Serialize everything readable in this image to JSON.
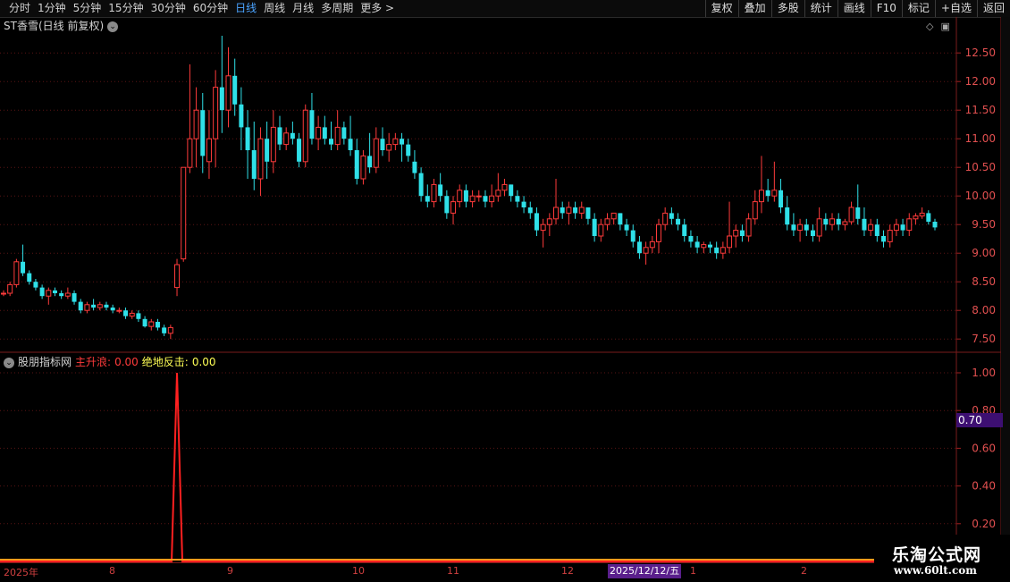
{
  "toolbar": {
    "periods": [
      "分时",
      "1分钟",
      "5分钟",
      "15分钟",
      "30分钟",
      "60分钟",
      "日线",
      "周线",
      "月线",
      "多周期",
      "更多 >"
    ],
    "active_period": "日线",
    "tools": [
      "复权",
      "叠加",
      "多股",
      "统计",
      "画线",
      "F10",
      "标记",
      "+自选",
      "返回"
    ]
  },
  "main_chart": {
    "title": "ST香雪(日线 前复权)",
    "price_axis": [
      "12.50",
      "12.00",
      "11.50",
      "11.00",
      "10.50",
      "10.00",
      "9.50",
      "9.00",
      "8.50",
      "8.00",
      "7.50"
    ]
  },
  "indicator": {
    "name": "股朋指标网",
    "line1_label": "主升浪:",
    "line1_value": "0.00",
    "line2_label": "绝地反击:",
    "line2_value": "0.00",
    "axis": [
      "1.00",
      "0.80",
      "0.60",
      "0.40",
      "0.20"
    ],
    "cursor_value": "0.70"
  },
  "date_axis": {
    "labels": [
      "2025年",
      "8",
      "9",
      "10",
      "11",
      "12",
      "1",
      "2"
    ],
    "highlight": "2025/12/12/五"
  },
  "watermark": {
    "line1": "乐淘公式网",
    "line2": "www.60lt.com"
  },
  "colors": {
    "up": "#ff3b3b",
    "down": "#2fe0e8",
    "background": "#000000",
    "grid": "#5a1414"
  },
  "chart_data": {
    "type": "candlestick",
    "ylim": [
      7.3,
      12.8
    ],
    "price_ticks": [
      7.5,
      8.0,
      8.5,
      9.0,
      9.5,
      10.0,
      10.5,
      11.0,
      11.5,
      12.0,
      12.5
    ],
    "candles": [
      [
        8.3,
        8.35,
        8.25,
        8.3
      ],
      [
        8.3,
        8.5,
        8.25,
        8.45
      ],
      [
        8.45,
        8.9,
        8.4,
        8.85
      ],
      [
        8.85,
        9.15,
        8.6,
        8.65
      ],
      [
        8.65,
        8.7,
        8.45,
        8.5
      ],
      [
        8.5,
        8.55,
        8.35,
        8.4
      ],
      [
        8.4,
        8.45,
        8.2,
        8.25
      ],
      [
        8.25,
        8.4,
        8.1,
        8.35
      ],
      [
        8.35,
        8.4,
        8.25,
        8.3
      ],
      [
        8.3,
        8.35,
        8.2,
        8.25
      ],
      [
        8.25,
        8.4,
        8.2,
        8.3
      ],
      [
        8.3,
        8.35,
        8.1,
        8.15
      ],
      [
        8.15,
        8.2,
        7.95,
        8.0
      ],
      [
        8.0,
        8.15,
        7.95,
        8.1
      ],
      [
        8.1,
        8.2,
        8.0,
        8.05
      ],
      [
        8.05,
        8.15,
        8.0,
        8.1
      ],
      [
        8.1,
        8.15,
        8.0,
        8.05
      ],
      [
        8.05,
        8.1,
        7.95,
        8.0
      ],
      [
        8.0,
        8.05,
        7.95,
        8.0
      ],
      [
        8.0,
        8.05,
        7.85,
        7.9
      ],
      [
        7.9,
        8.0,
        7.85,
        7.95
      ],
      [
        7.95,
        8.0,
        7.8,
        7.85
      ],
      [
        7.85,
        7.9,
        7.7,
        7.72
      ],
      [
        7.72,
        7.85,
        7.65,
        7.8
      ],
      [
        7.8,
        7.85,
        7.65,
        7.7
      ],
      [
        7.7,
        7.75,
        7.55,
        7.6
      ],
      [
        7.6,
        7.75,
        7.5,
        7.7
      ],
      [
        8.4,
        8.9,
        8.25,
        8.8
      ],
      [
        8.9,
        10.5,
        8.85,
        10.5
      ],
      [
        10.5,
        12.3,
        10.4,
        11.0
      ],
      [
        11.0,
        11.9,
        10.5,
        11.5
      ],
      [
        11.5,
        11.8,
        10.4,
        10.7
      ],
      [
        10.6,
        11.5,
        10.3,
        11.0
      ],
      [
        11.0,
        12.2,
        10.5,
        11.9
      ],
      [
        11.9,
        12.8,
        11.1,
        11.5
      ],
      [
        11.5,
        12.6,
        11.2,
        12.1
      ],
      [
        12.1,
        12.4,
        11.4,
        11.6
      ],
      [
        11.6,
        11.9,
        10.8,
        11.2
      ],
      [
        11.2,
        11.5,
        10.3,
        10.8
      ],
      [
        10.8,
        11.3,
        10.1,
        10.3
      ],
      [
        10.3,
        11.2,
        10.0,
        11.0
      ],
      [
        11.0,
        11.3,
        10.3,
        10.6
      ],
      [
        10.6,
        11.5,
        10.4,
        11.2
      ],
      [
        11.2,
        11.4,
        10.8,
        10.9
      ],
      [
        10.9,
        11.2,
        10.8,
        11.1
      ],
      [
        11.1,
        11.3,
        10.9,
        11.0
      ],
      [
        11.0,
        11.1,
        10.5,
        10.6
      ],
      [
        10.6,
        11.6,
        10.5,
        11.5
      ],
      [
        11.5,
        11.8,
        10.9,
        11.0
      ],
      [
        11.0,
        11.4,
        10.8,
        11.2
      ],
      [
        11.2,
        11.4,
        10.9,
        11.0
      ],
      [
        11.0,
        11.3,
        10.8,
        10.9
      ],
      [
        10.9,
        11.5,
        10.8,
        11.2
      ],
      [
        11.2,
        11.3,
        10.9,
        11.0
      ],
      [
        11.0,
        11.4,
        10.7,
        10.8
      ],
      [
        10.8,
        11.0,
        10.2,
        10.3
      ],
      [
        10.3,
        10.8,
        10.2,
        10.7
      ],
      [
        10.7,
        11.1,
        10.4,
        10.5
      ],
      [
        10.5,
        11.2,
        10.4,
        11.0
      ],
      [
        11.0,
        11.2,
        10.7,
        10.8
      ],
      [
        10.8,
        11.1,
        10.6,
        10.9
      ],
      [
        10.9,
        11.1,
        10.8,
        11.0
      ],
      [
        11.0,
        11.1,
        10.6,
        10.9
      ],
      [
        10.9,
        11.0,
        10.6,
        10.7
      ],
      [
        10.6,
        10.8,
        10.3,
        10.4
      ],
      [
        10.4,
        10.5,
        9.9,
        10.0
      ],
      [
        10.0,
        10.2,
        9.8,
        9.9
      ],
      [
        9.9,
        10.3,
        9.8,
        10.2
      ],
      [
        10.2,
        10.4,
        9.9,
        10.0
      ],
      [
        10.0,
        10.1,
        9.6,
        9.7
      ],
      [
        9.7,
        10.0,
        9.5,
        9.9
      ],
      [
        9.9,
        10.2,
        9.8,
        10.1
      ],
      [
        10.1,
        10.2,
        9.8,
        9.9
      ],
      [
        9.9,
        10.1,
        9.8,
        10.0
      ],
      [
        10.0,
        10.1,
        9.9,
        10.0
      ],
      [
        10.0,
        10.1,
        9.8,
        9.9
      ],
      [
        9.9,
        10.2,
        9.8,
        10.0
      ],
      [
        10.0,
        10.4,
        9.9,
        10.1
      ],
      [
        10.1,
        10.3,
        10.0,
        10.2
      ],
      [
        10.2,
        10.2,
        9.9,
        10.0
      ],
      [
        10.0,
        10.1,
        9.8,
        9.9
      ],
      [
        9.9,
        10.0,
        9.7,
        9.8
      ],
      [
        9.8,
        9.9,
        9.6,
        9.7
      ],
      [
        9.7,
        9.8,
        9.3,
        9.4
      ],
      [
        9.4,
        9.6,
        9.1,
        9.5
      ],
      [
        9.5,
        9.7,
        9.3,
        9.6
      ],
      [
        9.6,
        10.3,
        9.5,
        9.8
      ],
      [
        9.8,
        9.9,
        9.6,
        9.7
      ],
      [
        9.7,
        9.9,
        9.5,
        9.8
      ],
      [
        9.8,
        9.9,
        9.6,
        9.7
      ],
      [
        9.7,
        9.9,
        9.6,
        9.8
      ],
      [
        9.8,
        9.8,
        9.5,
        9.6
      ],
      [
        9.6,
        9.7,
        9.2,
        9.3
      ],
      [
        9.3,
        9.6,
        9.2,
        9.5
      ],
      [
        9.5,
        9.7,
        9.4,
        9.6
      ],
      [
        9.6,
        9.7,
        9.5,
        9.7
      ],
      [
        9.7,
        9.7,
        9.4,
        9.5
      ],
      [
        9.5,
        9.6,
        9.3,
        9.4
      ],
      [
        9.4,
        9.5,
        9.1,
        9.2
      ],
      [
        9.2,
        9.3,
        8.9,
        9.0
      ],
      [
        9.0,
        9.2,
        8.8,
        9.1
      ],
      [
        9.1,
        9.3,
        9.0,
        9.2
      ],
      [
        9.2,
        9.6,
        9.0,
        9.5
      ],
      [
        9.5,
        9.8,
        9.4,
        9.7
      ],
      [
        9.7,
        9.8,
        9.5,
        9.6
      ],
      [
        9.6,
        9.7,
        9.4,
        9.5
      ],
      [
        9.5,
        9.6,
        9.2,
        9.3
      ],
      [
        9.3,
        9.4,
        9.1,
        9.2
      ],
      [
        9.2,
        9.3,
        9.0,
        9.1
      ],
      [
        9.1,
        9.2,
        9.0,
        9.15
      ],
      [
        9.15,
        9.2,
        9.0,
        9.1
      ],
      [
        9.1,
        9.2,
        8.9,
        9.0
      ],
      [
        9.0,
        9.2,
        8.9,
        9.1
      ],
      [
        9.1,
        9.9,
        9.0,
        9.3
      ],
      [
        9.3,
        9.5,
        9.1,
        9.4
      ],
      [
        9.4,
        9.5,
        9.2,
        9.3
      ],
      [
        9.3,
        9.7,
        9.2,
        9.6
      ],
      [
        9.6,
        10.1,
        9.5,
        9.9
      ],
      [
        9.9,
        10.7,
        9.7,
        10.1
      ],
      [
        10.1,
        10.3,
        9.9,
        10.0
      ],
      [
        10.0,
        10.6,
        9.9,
        10.1
      ],
      [
        10.1,
        10.3,
        9.7,
        9.8
      ],
      [
        9.8,
        10.0,
        9.4,
        9.5
      ],
      [
        9.5,
        9.7,
        9.3,
        9.4
      ],
      [
        9.4,
        9.6,
        9.2,
        9.5
      ],
      [
        9.5,
        9.6,
        9.3,
        9.4
      ],
      [
        9.4,
        9.5,
        9.2,
        9.3
      ],
      [
        9.3,
        9.8,
        9.2,
        9.6
      ],
      [
        9.6,
        9.7,
        9.4,
        9.5
      ],
      [
        9.5,
        9.7,
        9.4,
        9.6
      ],
      [
        9.6,
        9.7,
        9.4,
        9.5
      ],
      [
        9.5,
        9.6,
        9.4,
        9.55
      ],
      [
        9.55,
        9.9,
        9.5,
        9.8
      ],
      [
        9.8,
        10.2,
        9.5,
        9.6
      ],
      [
        9.6,
        9.8,
        9.3,
        9.4
      ],
      [
        9.4,
        9.6,
        9.3,
        9.5
      ],
      [
        9.5,
        9.6,
        9.2,
        9.3
      ],
      [
        9.3,
        9.4,
        9.1,
        9.2
      ],
      [
        9.2,
        9.5,
        9.1,
        9.4
      ],
      [
        9.4,
        9.6,
        9.3,
        9.5
      ],
      [
        9.5,
        9.6,
        9.3,
        9.4
      ],
      [
        9.4,
        9.7,
        9.3,
        9.6
      ],
      [
        9.6,
        9.7,
        9.5,
        9.65
      ],
      [
        9.65,
        9.8,
        9.6,
        9.7
      ],
      [
        9.7,
        9.75,
        9.5,
        9.55
      ],
      [
        9.55,
        9.6,
        9.4,
        9.45
      ]
    ],
    "indicator_series": [
      {
        "name": "主升浪",
        "type": "spike",
        "spike_at_index": 27,
        "spike_value": 1.0
      }
    ]
  }
}
